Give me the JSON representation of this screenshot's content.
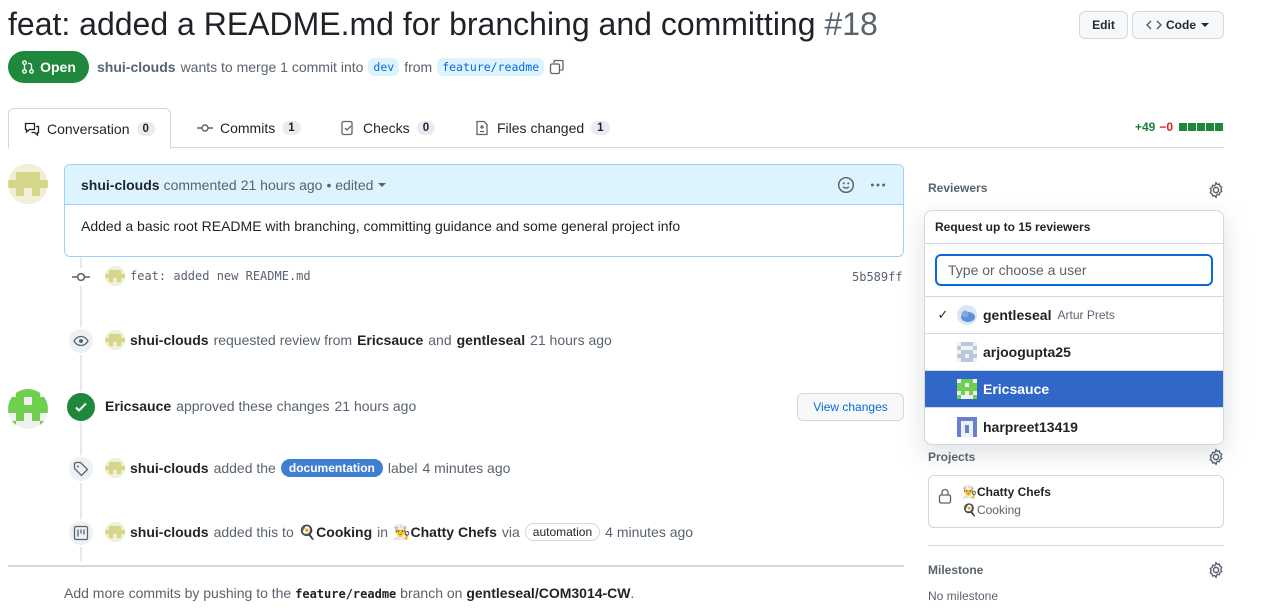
{
  "header": {
    "title": "feat: added a README.md for branching and committing",
    "number": "#18",
    "edit_label": "Edit",
    "code_label": "Code"
  },
  "state": {
    "label": "Open",
    "author": "shui-clouds",
    "merge_text_1": "wants to merge 1 commit into",
    "base_branch": "dev",
    "from_text": "from",
    "head_branch": "feature/readme"
  },
  "tabs": [
    {
      "label": "Conversation",
      "count": "0"
    },
    {
      "label": "Commits",
      "count": "1"
    },
    {
      "label": "Checks",
      "count": "0"
    },
    {
      "label": "Files changed",
      "count": "1"
    }
  ],
  "diffstat": {
    "additions": "+49",
    "deletions": "−0"
  },
  "comment": {
    "author": "shui-clouds",
    "verb": "commented",
    "time": "21 hours ago",
    "edited": "• edited",
    "body": "Added a basic root README with branching, committing guidance and some general project info"
  },
  "commit": {
    "message": "feat: added new README.md",
    "sha": "5b589ff"
  },
  "events": {
    "review_request": {
      "actor": "shui-clouds",
      "text1": "requested review from",
      "user1": "Ericsauce",
      "and": "and",
      "user2": "gentleseal",
      "time": "21 hours ago"
    },
    "approval": {
      "actor": "Ericsauce",
      "text": "approved these changes",
      "time": "21 hours ago",
      "button": "View changes"
    },
    "label": {
      "actor": "shui-clouds",
      "text1": "added the",
      "label": "documentation",
      "text2": "label",
      "time": "4 minutes ago"
    },
    "project": {
      "actor": "shui-clouds",
      "text1": "added this to",
      "column": "🍳Cooking",
      "in": "in",
      "project": "👨‍🍳Chatty Chefs",
      "via": "via",
      "automation": "automation",
      "time": "4 minutes ago"
    }
  },
  "footer": {
    "text1": "Add more commits by pushing to the",
    "branch": "feature/readme",
    "text2": "branch on",
    "repo": "gentleseal/COM3014-CW",
    "end": "."
  },
  "sidebar": {
    "reviewers_heading": "Reviewers",
    "popup": {
      "title": "Request up to 15 reviewers",
      "placeholder": "Type or choose a user",
      "users": [
        {
          "login": "gentleseal",
          "name": "Artur Prets",
          "checked": true
        },
        {
          "login": "arjoogupta25",
          "name": "",
          "checked": false
        },
        {
          "login": "Ericsauce",
          "name": "",
          "checked": false
        },
        {
          "login": "harpreet13419",
          "name": "",
          "checked": false
        }
      ]
    },
    "projects_heading": "Projects",
    "project_name": "👨‍🍳Chatty Chefs",
    "project_column": "🍳Cooking",
    "milestone_heading": "Milestone",
    "milestone_value": "No milestone"
  },
  "colors": {
    "open": "#1f883d",
    "link": "#0969da",
    "selected_row": "#3067c8",
    "label": "#3f7fd1"
  }
}
